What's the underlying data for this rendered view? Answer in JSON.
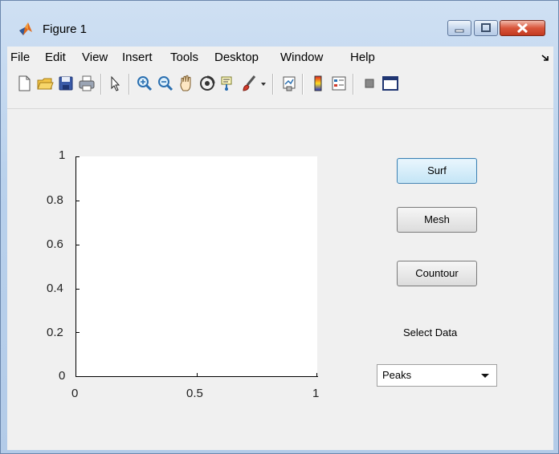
{
  "window": {
    "title": "Figure 1"
  },
  "menu": [
    {
      "label": "File"
    },
    {
      "label": "Edit"
    },
    {
      "label": "View"
    },
    {
      "label": "Insert"
    },
    {
      "label": "Tools"
    },
    {
      "label": "Desktop"
    },
    {
      "label": "Window"
    },
    {
      "label": "Help"
    }
  ],
  "toolbar": {
    "icons": [
      "new-figure-icon",
      "open-file-icon",
      "save-figure-icon",
      "print-figure-icon",
      "edit-plot-icon",
      "zoom-in-icon",
      "zoom-out-icon",
      "pan-icon",
      "rotate-3d-icon",
      "data-cursor-icon",
      "brush-icon",
      "link-plot-icon",
      "colorbar-icon",
      "legend-icon",
      "hide-plot-tools-icon",
      "show-plot-tools-icon"
    ]
  },
  "axes": {
    "x_ticks": [
      "0",
      "0.5",
      "1"
    ],
    "y_ticks": [
      "1",
      "0.8",
      "0.6",
      "0.4",
      "0.2",
      "0"
    ]
  },
  "controls": {
    "surf_label": "Surf",
    "mesh_label": "Mesh",
    "contour_label": "Countour",
    "select_label": "Select Data",
    "select_value": "Peaks"
  },
  "colors": {
    "accent": "#3c7fb1",
    "close_button": "#c33a20"
  }
}
